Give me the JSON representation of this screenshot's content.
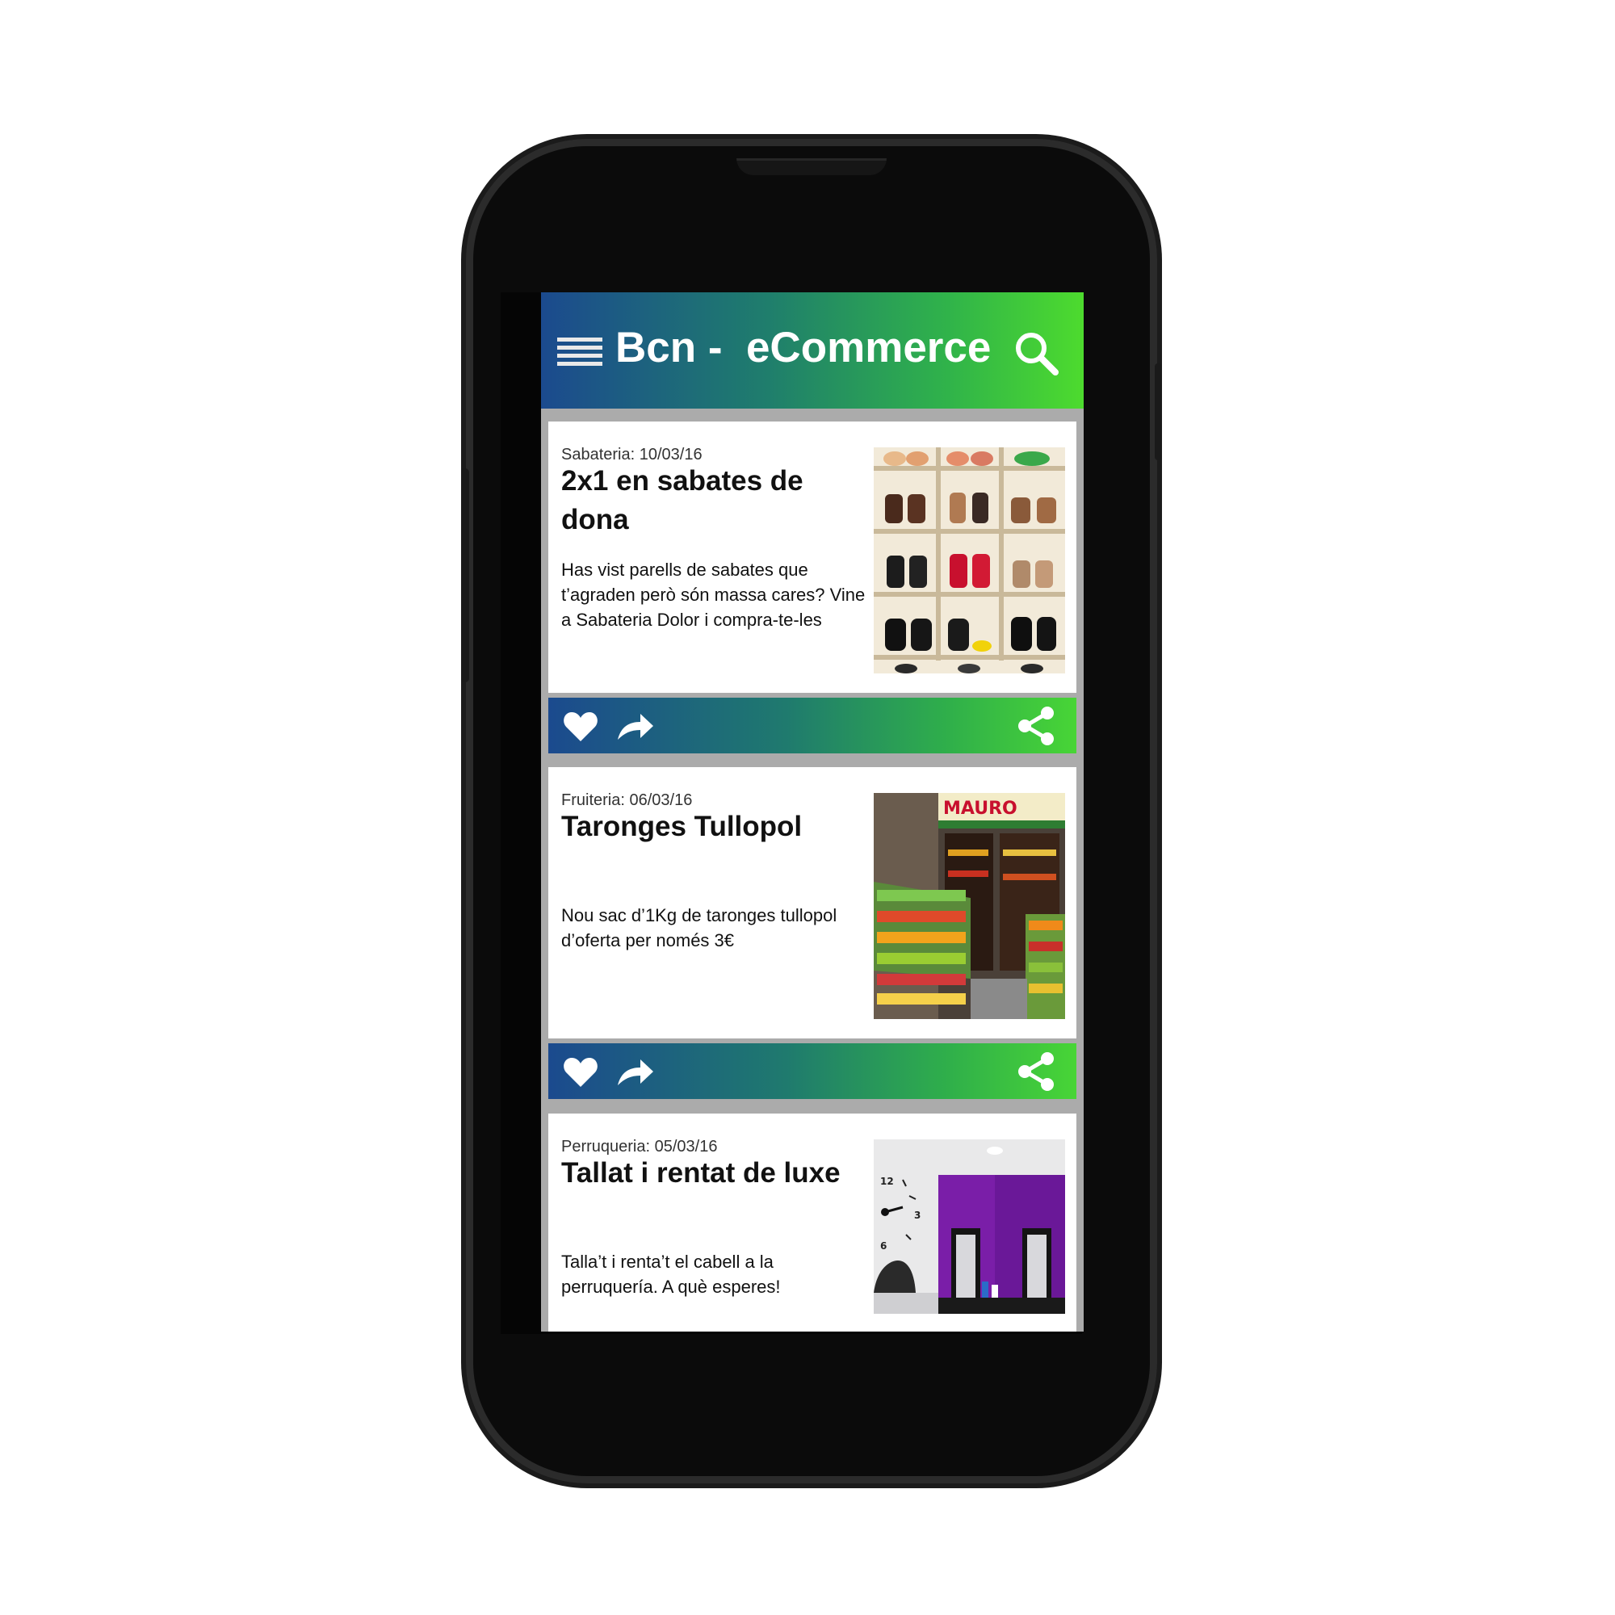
{
  "app": {
    "title": "Bcn -  eCommerce",
    "gradient_start": "#1b4a8e",
    "gradient_end": "#4ddb2e"
  },
  "icons": {
    "menu": "menu-icon",
    "search": "search-icon",
    "like": "heart-icon",
    "forward": "forward-arrow-icon",
    "share": "share-icon"
  },
  "feed": [
    {
      "category_date": "Sabateria: 10/03/16",
      "title": "2x1 en sabates de dona",
      "description": "Has vist parells de sabates que t’agraden però són massa cares? Vine a Sabateria Dolor i compra-te-les",
      "image": "shoe-shelves-photo"
    },
    {
      "category_date": "Fruiteria: 06/03/16",
      "title": "Taronges Tullopol",
      "description": "Nou sac d’1Kg de taronges tullopol d’oferta per només 3€",
      "image": "fruit-shop-photo"
    },
    {
      "category_date": "Perruqueria: 05/03/16",
      "title": "Tallat i rentat de luxe",
      "description": "Talla’t i renta’t el cabell a la perruquería. A què esperes!",
      "image": "hair-salon-photo"
    }
  ]
}
